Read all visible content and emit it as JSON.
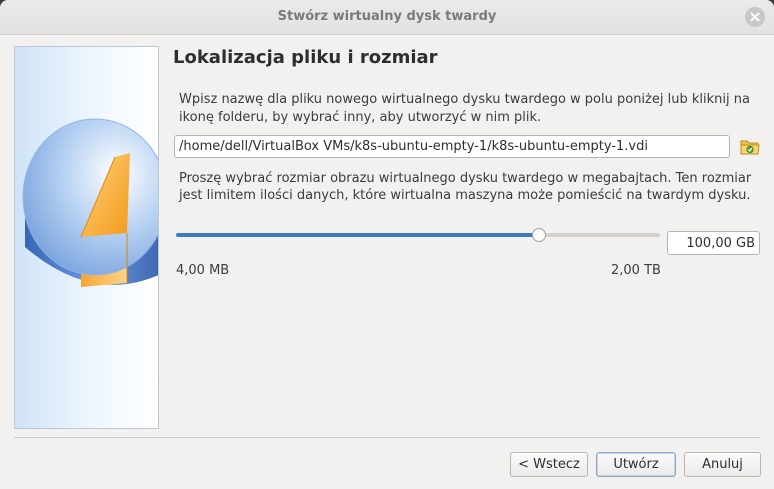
{
  "window": {
    "title": "Stwórz wirtualny dysk twardy"
  },
  "page": {
    "heading": "Lokalizacja pliku i rozmiar",
    "description_location": "Wpisz nazwę dla pliku nowego wirtualnego dysku twardego w polu poniżej lub kliknij na ikonę folderu, by wybrać inny, aby utworzyć w nim plik.",
    "file_path": "/home/dell/VirtualBox VMs/k8s-ubuntu-empty-1/k8s-ubuntu-empty-1.vdi",
    "description_size": "Proszę wybrać rozmiar obrazu wirtualnego dysku twardego w megabajtach. Ten rozmiar jest limitem ilości danych, które wirtualna maszyna może pomieścić na twardym dysku.",
    "size": {
      "value": "100,00 GB",
      "min_label": "4,00 MB",
      "max_label": "2,00 TB",
      "slider_position_fraction": 0.75
    }
  },
  "buttons": {
    "back": "< Wstecz",
    "create": "Utwórz",
    "cancel": "Anuluj"
  },
  "icons": {
    "close": "close-icon",
    "folder": "folder-icon",
    "wizard": "hard-disk-icon"
  },
  "colors": {
    "accent": "#3d7bbf",
    "disk_blue": "#5b8fd6",
    "disk_orange": "#f5a623"
  }
}
